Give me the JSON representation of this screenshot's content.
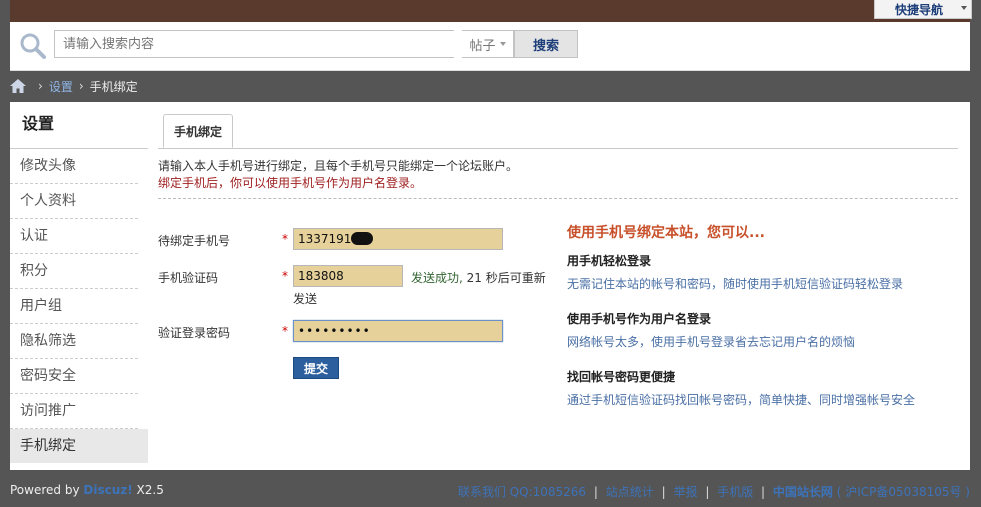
{
  "topbar": {
    "quick_nav_label": "快捷导航"
  },
  "search": {
    "placeholder": "请输入搜索内容",
    "type_label": "帖子",
    "button_label": "搜索"
  },
  "breadcrumb": {
    "settings": "设置",
    "sep": "›",
    "current": "手机绑定"
  },
  "sidebar": {
    "title": "设置",
    "items": [
      {
        "label": "修改头像"
      },
      {
        "label": "个人资料"
      },
      {
        "label": "认证"
      },
      {
        "label": "积分"
      },
      {
        "label": "用户组"
      },
      {
        "label": "隐私筛选"
      },
      {
        "label": "密码安全"
      },
      {
        "label": "访问推广"
      },
      {
        "label": "手机绑定",
        "active": true
      }
    ]
  },
  "content": {
    "tab_label": "手机绑定",
    "intro_line1": "请输入本人手机号进行绑定，且每个手机号只能绑定一个论坛账户。",
    "intro_line2": "绑定手机后，你可以使用手机号作为用户名登录。",
    "form": {
      "phone_label": "待绑定手机号",
      "phone_value": "13371918",
      "code_label": "手机验证码",
      "code_value": "183808",
      "sms_success": "发送成功,",
      "sms_countdown": " 21 秒后可重新",
      "sms_countdown_cont": "发送",
      "password_label": "验证登录密码",
      "password_value": "•••••••••",
      "required_mark": "*",
      "submit_label": "提交"
    },
    "benefits": {
      "title": "使用手机号绑定本站，您可以...",
      "items": [
        {
          "title": "用手机轻松登录",
          "desc": "无需记住本站的帐号和密码，随时使用手机短信验证码轻松登录"
        },
        {
          "title": "使用手机号作为用户名登录",
          "desc": "网络帐号太多，使用手机号登录省去忘记用户名的烦恼"
        },
        {
          "title": "找回帐号密码更便捷",
          "desc": "通过手机短信验证码找回帐号密码，简单快捷、同时增强帐号安全"
        }
      ]
    }
  },
  "footer": {
    "powered_by": "Powered by ",
    "brand": "Discuz!",
    "version": " X2.5",
    "contact": "联系我们 QQ:1085266",
    "stats": "站点统计",
    "report": "举报",
    "mobile": "手机版",
    "site_name": "中国站长网",
    "icp": "( 沪ICP备05038105号 )",
    "pipe": "|"
  },
  "colors": {
    "accent": "#2c5f9e",
    "warning": "#c8502a",
    "input_fill": "#e6d19a",
    "header_brown": "#5a3a2c"
  }
}
